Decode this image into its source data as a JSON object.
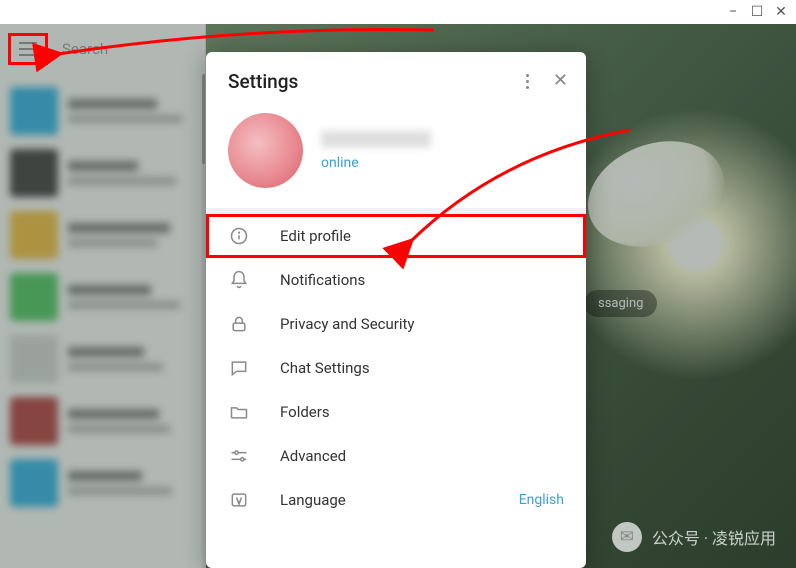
{
  "window": {
    "minimize": "_",
    "maximize": "☐",
    "close": "✕"
  },
  "search": {
    "placeholder": "Search"
  },
  "background_badge": "ssaging",
  "settings": {
    "title": "Settings",
    "status": "online",
    "items": [
      {
        "id": "edit-profile",
        "label": "Edit profile"
      },
      {
        "id": "notifications",
        "label": "Notifications"
      },
      {
        "id": "privacy",
        "label": "Privacy and Security"
      },
      {
        "id": "chat",
        "label": "Chat Settings"
      },
      {
        "id": "folders",
        "label": "Folders"
      },
      {
        "id": "advanced",
        "label": "Advanced"
      },
      {
        "id": "language",
        "label": "Language",
        "value": "English"
      }
    ]
  },
  "watermark": "公众号 · 凌锐应用"
}
